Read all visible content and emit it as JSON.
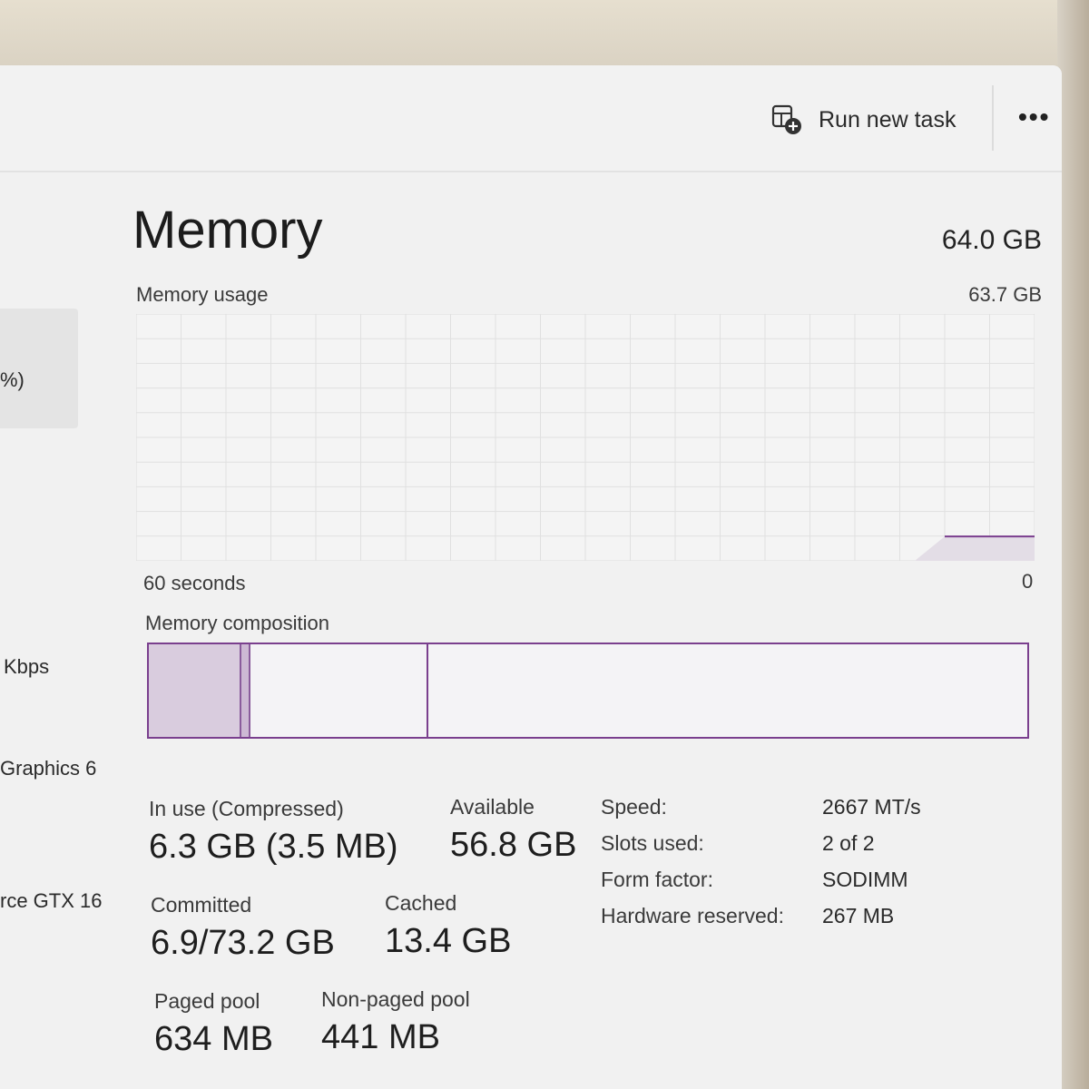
{
  "toolbar": {
    "run_new_task": "Run new task",
    "more": "•••"
  },
  "sidebar": {
    "items": [
      {
        "label": "%)"
      },
      {
        "label": "Kbps"
      },
      {
        "label": "Graphics 6"
      },
      {
        "label": "rce GTX 16"
      }
    ]
  },
  "memory": {
    "title": "Memory",
    "total": "64.0 GB",
    "usage_label": "Memory usage",
    "usage_max": "63.7 GB",
    "time_left": "60 seconds",
    "time_right": "0",
    "composition_label": "Memory composition",
    "accent_color": "#7a3f8e"
  },
  "chart_data": {
    "type": "area",
    "title": "Memory usage",
    "xlabel": "",
    "ylabel": "",
    "x_range_seconds": [
      60,
      0
    ],
    "ylim": [
      0,
      63.7
    ],
    "grid": true,
    "series": [
      {
        "x": [
          60,
          8,
          6,
          0
        ],
        "values": [
          0,
          0,
          6.3,
          6.3
        ]
      }
    ]
  },
  "stats": {
    "in_use_label": "In use (Compressed)",
    "in_use_value": "6.3 GB (3.5 MB)",
    "available_label": "Available",
    "available_value": "56.8 GB",
    "committed_label": "Committed",
    "committed_value": "6.9/73.2 GB",
    "cached_label": "Cached",
    "cached_value": "13.4 GB",
    "paged_label": "Paged pool",
    "paged_value": "634 MB",
    "nonpaged_label": "Non-paged pool",
    "nonpaged_value": "441 MB"
  },
  "details": [
    {
      "key": "Speed:",
      "value": "2667 MT/s"
    },
    {
      "key": "Slots used:",
      "value": "2 of 2"
    },
    {
      "key": "Form factor:",
      "value": "SODIMM"
    },
    {
      "key": "Hardware reserved:",
      "value": "267 MB"
    }
  ]
}
